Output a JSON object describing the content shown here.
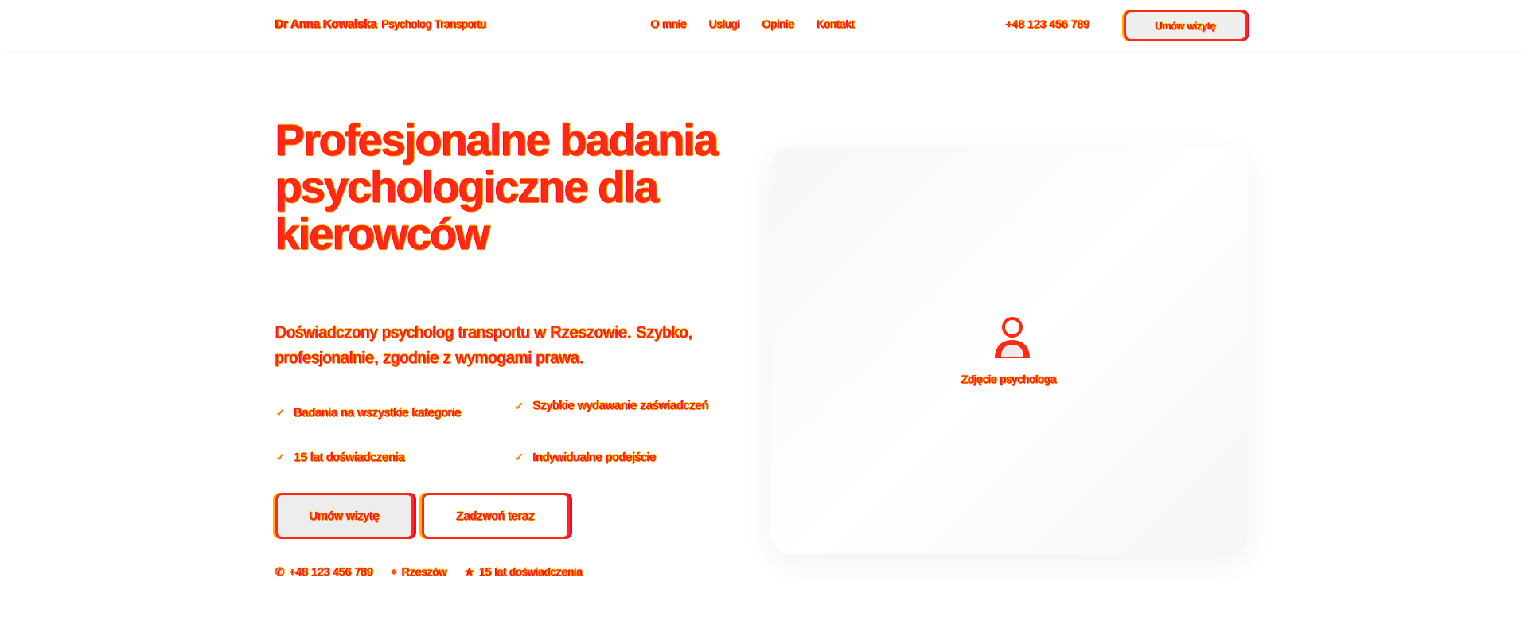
{
  "header": {
    "brand_name": "Dr Anna Kowalska",
    "brand_sub": "Psycholog Transportu",
    "nav": [
      "O mnie",
      "Usługi",
      "Opinie",
      "Kontakt"
    ],
    "phone": "+48 123 456 789",
    "cta": "Umów wizytę"
  },
  "hero": {
    "title": "Profesjonalne badania psychologiczne dla kierowców",
    "description": "Doświadczony psycholog transportu w Rzeszowie. Szybko, profesjonalnie, zgodnie z wymogami prawa.",
    "features": [
      "Badania na wszystkie kategorie",
      "Szybkie wydawanie zaświadczeń",
      "15 lat doświadczenia",
      "Indywidualne podejście"
    ],
    "primary_button": "Umów wizytę",
    "secondary_button": "Zadzwoń teraz",
    "meta": {
      "phone": "+48 123 456 789",
      "city": "Rzeszów",
      "experience": "15 lat doświadczenia"
    }
  },
  "card": {
    "label": "Zdjęcie psychologa",
    "icon": "user-icon"
  },
  "colors": {
    "accent": "#ff2a12",
    "accent_alt": "#ffb200",
    "card_bg": "#f7f7f7"
  }
}
